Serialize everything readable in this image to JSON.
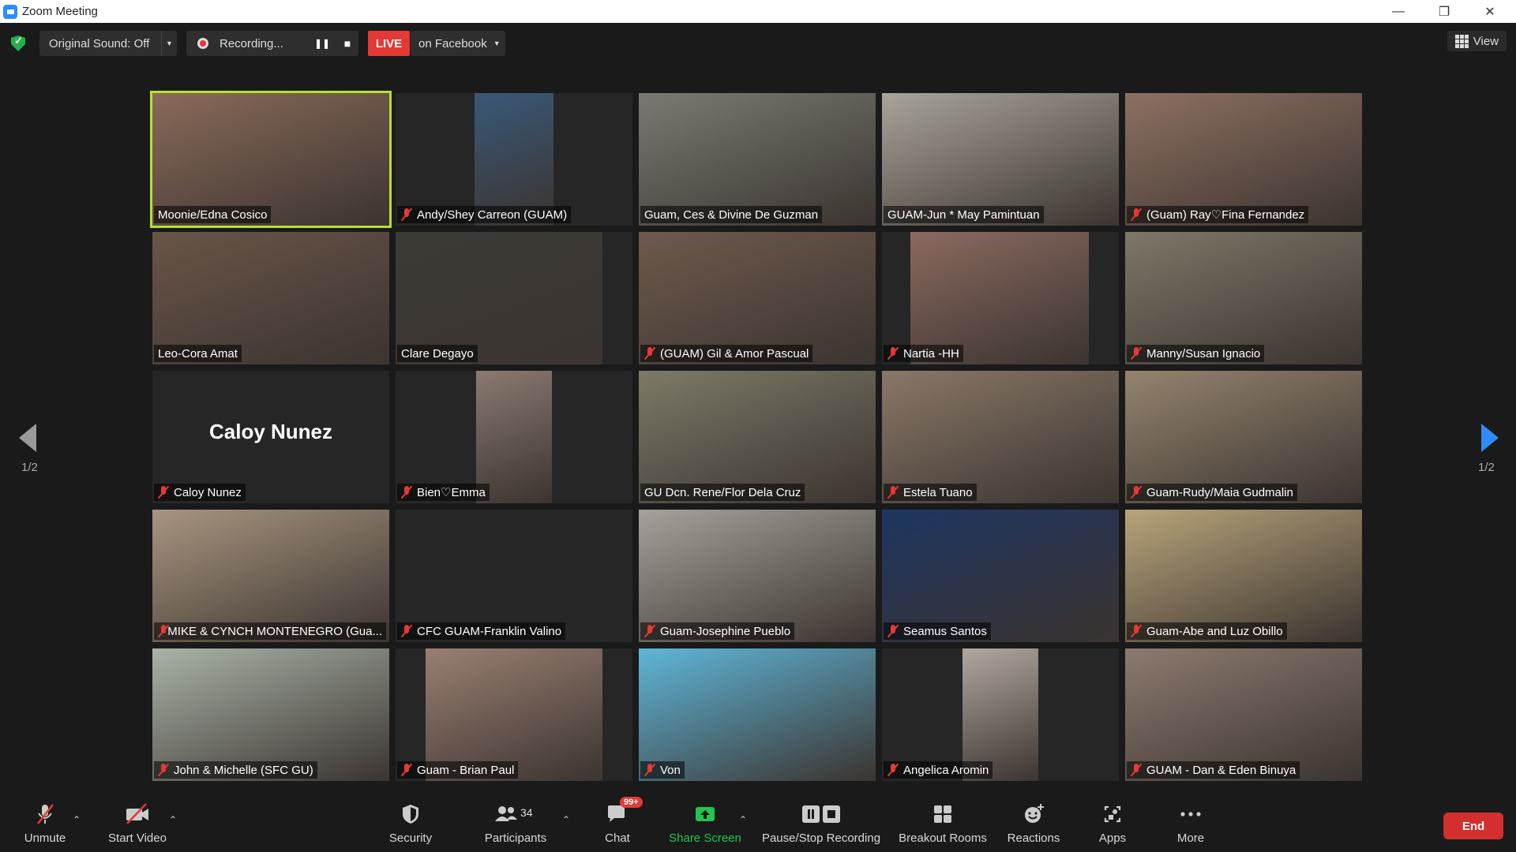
{
  "window": {
    "title": "Zoom Meeting",
    "controls": [
      "—",
      "❐",
      "✕"
    ]
  },
  "meeting_bar": {
    "original_sound": "Original Sound: Off",
    "recording": "Recording...",
    "live_badge": "LIVE",
    "live_target": "on Facebook",
    "view": "View"
  },
  "pagination": {
    "left": "1/2",
    "right": "1/2"
  },
  "tiles": [
    {
      "name": "Moonie/Edna Cosico",
      "muted": false,
      "active": true,
      "bg": "#8a6a5a",
      "vx": 0,
      "vw": 300
    },
    {
      "name": "Andy/Shey Carreon (GUAM)",
      "muted": true,
      "bg": "#3a5878",
      "vx": 100,
      "vw": 100
    },
    {
      "name": "Guam, Ces & Divine De Guzman",
      "muted": false,
      "bg": "#7a7a72",
      "vx": 0,
      "vw": 300
    },
    {
      "name": "GUAM-Jun * May  Pamintuan",
      "muted": false,
      "bg": "#a9a49a",
      "vx": 0,
      "vw": 300
    },
    {
      "name": "(Guam) Ray♡Fina Fernandez",
      "muted": true,
      "bg": "#8e7062",
      "vx": 0,
      "vw": 300
    },
    {
      "name": "Leo-Cora Amat",
      "muted": false,
      "bg": "#6a5548",
      "vx": 0,
      "vw": 300
    },
    {
      "name": "Clare Degayo",
      "muted": false,
      "bg": "#3d3a36",
      "vx": 0,
      "vw": 262
    },
    {
      "name": "(GUAM) Gil & Amor Pascual",
      "muted": true,
      "bg": "#6f5a4d",
      "vx": 0,
      "vw": 300
    },
    {
      "name": "Nartia -HH",
      "muted": true,
      "bg": "#8b6a60",
      "vx": 36,
      "vw": 226
    },
    {
      "name": "Manny/Susan Ignacio",
      "muted": true,
      "bg": "#7d7868",
      "vx": 0,
      "vw": 300
    },
    {
      "name": "Caloy Nunez",
      "muted": true,
      "bg": "",
      "vx": 0,
      "vw": 0,
      "big": "Caloy Nunez"
    },
    {
      "name": "Bien♡Emma",
      "muted": true,
      "bg": "#8a7a70",
      "vx": 102,
      "vw": 96
    },
    {
      "name": "GU Dcn. Rene/Flor Dela Cruz",
      "muted": false,
      "bg": "#7c7a68",
      "vx": 0,
      "vw": 300
    },
    {
      "name": "Estela Tuano",
      "muted": true,
      "bg": "#8a7868",
      "vx": 0,
      "vw": 300
    },
    {
      "name": "Guam-Rudy/Maia Gudmalin",
      "muted": true,
      "bg": "#94836f",
      "vx": 0,
      "vw": 300
    },
    {
      "name": "MIKE & CYNCH MONTENEGRO (Gua...",
      "muted": true,
      "bg": "#a89580",
      "vx": 0,
      "vw": 300
    },
    {
      "name": "CFC GUAM-Franklin Valino",
      "muted": true,
      "bg": "",
      "vx": 0,
      "vw": 0
    },
    {
      "name": "Guam-Josephine Pueblo",
      "muted": true,
      "bg": "#a6a19a",
      "vx": 0,
      "vw": 300
    },
    {
      "name": "Seamus Santos",
      "muted": true,
      "bg": "#1e3560",
      "vx": 0,
      "vw": 300
    },
    {
      "name": "Guam-Abe and Luz Obillo",
      "muted": true,
      "bg": "#b8a47a",
      "vx": 0,
      "vw": 300
    },
    {
      "name": "John & Michelle (SFC GU)",
      "muted": true,
      "bg": "#a9b3a8",
      "vx": 0,
      "vw": 300
    },
    {
      "name": "Guam - Brian Paul",
      "muted": true,
      "bg": "#9a7f72",
      "vx": 38,
      "vw": 224
    },
    {
      "name": "Von",
      "muted": true,
      "bg": "#5fb6d8",
      "vx": 0,
      "vw": 300
    },
    {
      "name": "Angelica Aromin",
      "muted": true,
      "bg": "#b0a8a0",
      "vx": 102,
      "vw": 96
    },
    {
      "name": "GUAM - Dan & Eden Binuya",
      "muted": true,
      "bg": "#8c7a6f",
      "vx": 0,
      "vw": 300
    }
  ],
  "toolbar": {
    "unmute": "Unmute",
    "start_video": "Start Video",
    "security": "Security",
    "participants": "Participants",
    "participants_count": "34",
    "chat": "Chat",
    "chat_badge": "99+",
    "share_screen": "Share Screen",
    "pause_stop_recording": "Pause/Stop Recording",
    "breakout_rooms": "Breakout Rooms",
    "reactions": "Reactions",
    "apps": "Apps",
    "more": "More",
    "end": "End"
  },
  "colors": {
    "accent_green": "#23b14d",
    "live_red": "#e53935",
    "active_speaker": "#b6e02e",
    "share_green": "#23c552",
    "end_red": "#d32f2f"
  }
}
